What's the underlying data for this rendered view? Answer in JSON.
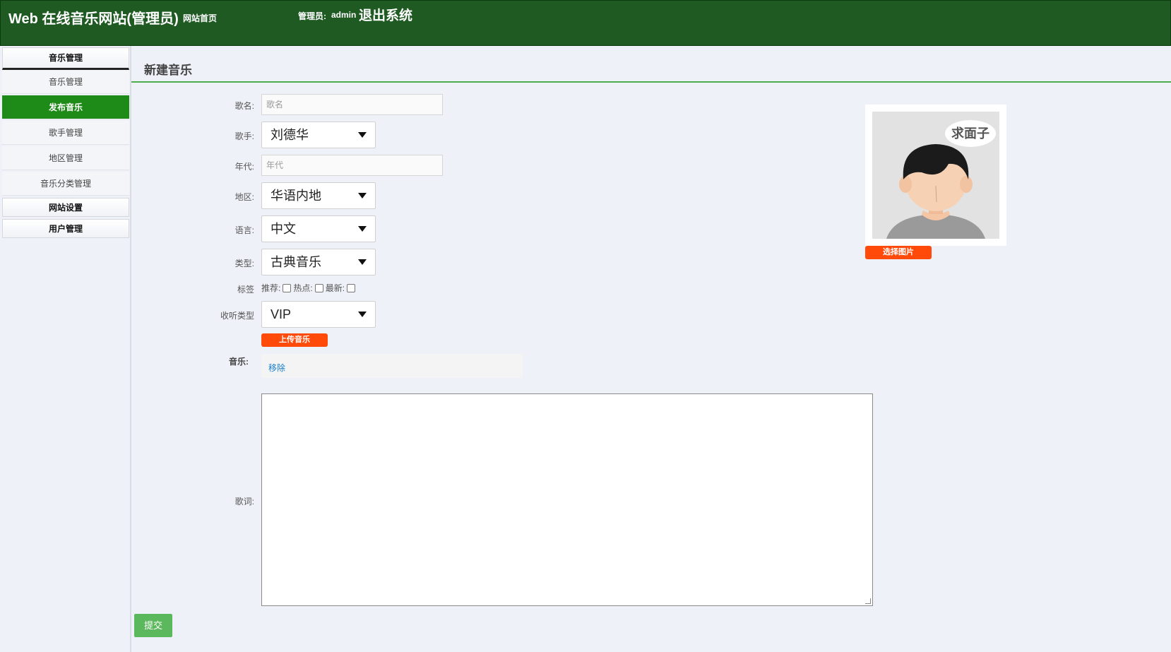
{
  "header": {
    "site_title": "Web 在线音乐网站(管理员)",
    "home_link": "网站首页",
    "admin_label": "管理员:",
    "admin_name": "admin",
    "logout": "退出系统"
  },
  "sidebar": {
    "music_section": "音乐管理",
    "items": [
      "音乐管理",
      "发布音乐",
      "歌手管理",
      "地区管理",
      "音乐分类管理"
    ],
    "active_item": "发布音乐",
    "site_settings": "网站设置",
    "user_management": "用户管理"
  },
  "page": {
    "title": "新建音乐"
  },
  "form": {
    "song_name_label": "歌名:",
    "song_name_placeholder": "歌名",
    "singer_label": "歌手:",
    "singer_value": "刘德华",
    "era_label": "年代:",
    "era_placeholder": "年代",
    "region_label": "地区:",
    "region_value": "华语内地",
    "language_label": "语言:",
    "language_value": "中文",
    "type_label": "类型:",
    "type_value": "古典音乐",
    "tags_label": "标签",
    "tag_recommend": "推荐:",
    "tag_hot": "热点:",
    "tag_new": "最新:",
    "listen_type_label": "收听类型",
    "listen_type_value": "VIP",
    "upload_music": "上传音乐",
    "music_label": "音乐:",
    "remove": "移除",
    "lyrics_label": "歌词:",
    "submit": "提交"
  },
  "image_panel": {
    "bubble_text": "求面子",
    "select_image": "选择图片"
  },
  "colors": {
    "header_bg": "#1e5a22",
    "active_menu": "#1e8a18",
    "orange_button": "#ff4a0a",
    "submit_button": "#5cb85c"
  }
}
